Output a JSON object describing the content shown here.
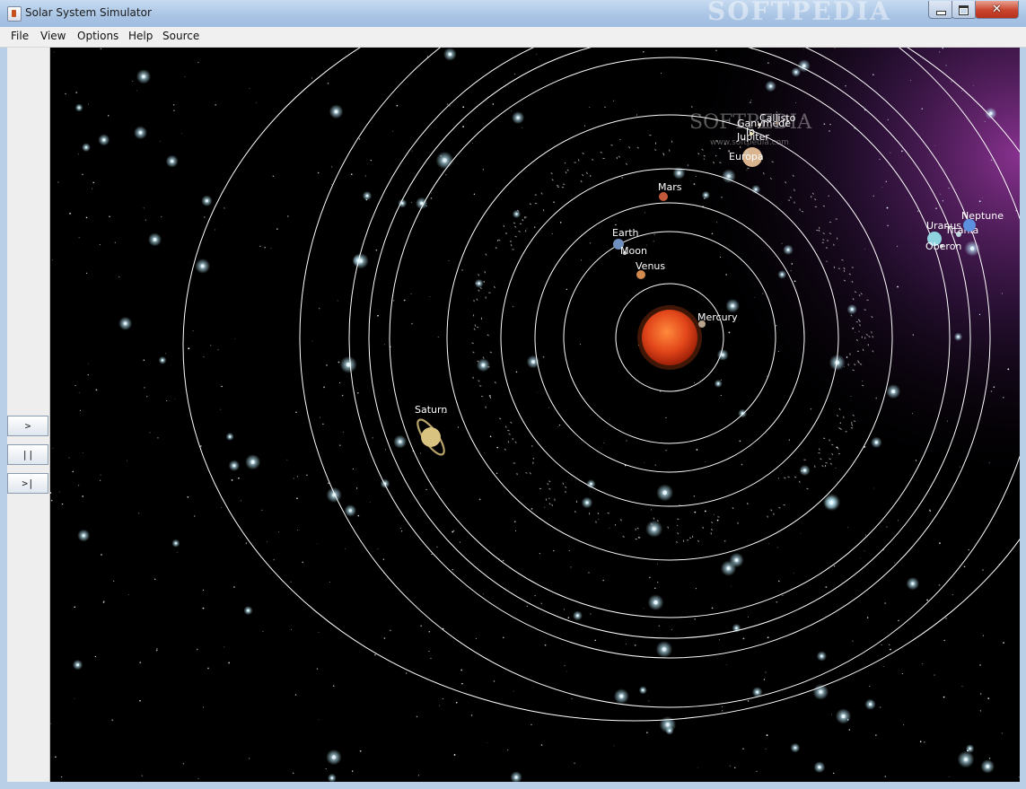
{
  "window": {
    "title": "Solar System Simulator",
    "watermark": "SOFTPEDIA",
    "minimize_icon": "minimize-icon",
    "maximize_icon": "maximize-icon",
    "close_icon": "close-icon",
    "close_glyph": "✕"
  },
  "menu": {
    "items": [
      "File",
      "View",
      "Options",
      "Help",
      "Source"
    ]
  },
  "controls": {
    "play_label": ">",
    "pause_label": "||",
    "step_label": ">|"
  },
  "scene": {
    "sun_color": "#e2461a",
    "orbit_color": "#ffffff",
    "nebula_color": "#7a2f86",
    "watermark_text": "SOFTPEDIA",
    "watermark_url": "www.softpedia.com",
    "bodies": [
      {
        "name": "Mercury"
      },
      {
        "name": "Venus"
      },
      {
        "name": "Earth"
      },
      {
        "name": "Moon"
      },
      {
        "name": "Mars"
      },
      {
        "name": "Jupiter"
      },
      {
        "name": "Io"
      },
      {
        "name": "Europa"
      },
      {
        "name": "Ganymede"
      },
      {
        "name": "Callisto"
      },
      {
        "name": "Saturn"
      },
      {
        "name": "Uranus"
      },
      {
        "name": "Titania"
      },
      {
        "name": "Oberon"
      },
      {
        "name": "Neptune"
      }
    ]
  }
}
